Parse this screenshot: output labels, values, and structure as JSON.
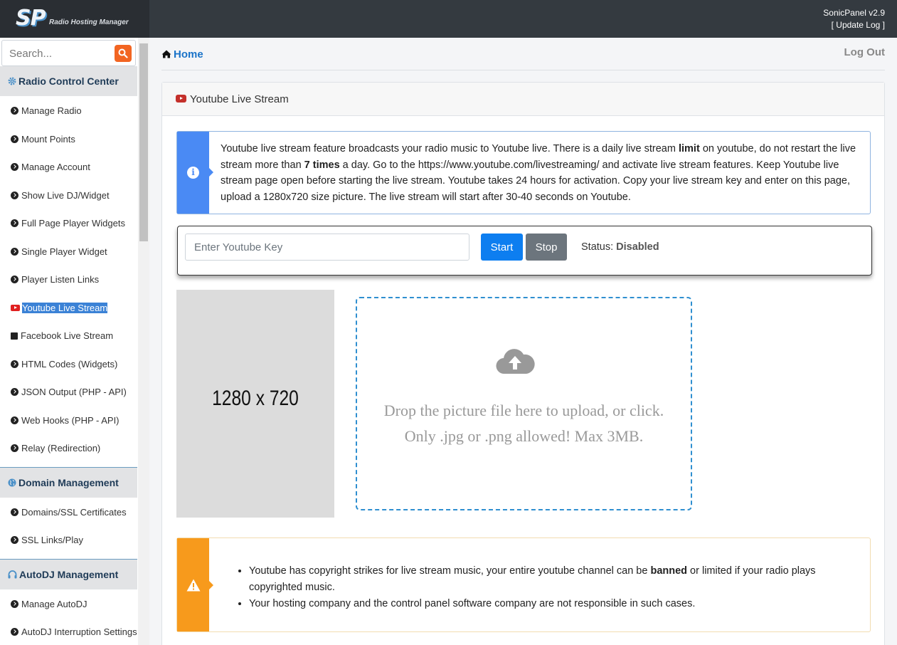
{
  "header": {
    "logo": "SP",
    "logo_subtitle": "Radio Hosting Manager",
    "version": "SonicPanel v2.9",
    "update_log": "[ Update Log ]"
  },
  "sidebar": {
    "search_placeholder": "Search...",
    "sections": [
      {
        "title": "Radio Control Center",
        "items": [
          "Manage Radio",
          "Mount Points",
          "Manage Account",
          "Show Live DJ/Widget",
          "Full Page Player Widgets",
          "Single Player Widget",
          "Player Listen Links",
          "Youtube Live Stream",
          "Facebook Live Stream",
          "HTML Codes (Widgets)",
          "JSON Output (PHP - API)",
          "Web Hooks (PHP - API)",
          "Relay (Redirection)"
        ]
      },
      {
        "title": "Domain Management",
        "items": [
          "Domains/SSL Certificates",
          "SSL Links/Play"
        ]
      },
      {
        "title": "AutoDJ Management",
        "items": [
          "Manage AutoDJ",
          "AutoDJ Interruption Settings"
        ]
      }
    ]
  },
  "main": {
    "breadcrumb_home": "Home",
    "logout": "Log Out",
    "card_title": "Youtube Live Stream",
    "info": {
      "t1": "Youtube live stream feature broadcasts your radio music to Youtube live. There is a daily live stream ",
      "b1": "limit",
      "t2": " on youtube, do not restart the live stream more than ",
      "b2": "7 times",
      "t3": " a day. Go to the https://www.youtube.com/livestreaming/ and activate live stream features. Keep Youtube live stream page open before starting the live stream. Youtube takes 24 hours for activation. Copy your live stream key and enter on this page, upload a 1280x720 size picture. The live stream will start after 30-40 seconds on Youtube."
    },
    "key_placeholder": "Enter Youtube Key",
    "start_label": "Start",
    "stop_label": "Stop",
    "status_label": "Status:",
    "status_value": "Disabled",
    "preview_text": "1280 x 720",
    "drop_line1": "Drop the picture file here to upload, or click.",
    "drop_line2": "Only .jpg or .png allowed! Max 3MB.",
    "warnings": {
      "w1a": "Youtube has copyright strikes for live stream music, your entire youtube channel can be ",
      "w1b": "banned",
      "w1c": " or limited if your radio plays copyrighted music.",
      "w2": "Your hosting company and the control panel software company are not responsible in such cases."
    }
  },
  "colors": {
    "topbar": "#343a40",
    "accent": "#0d7ef0",
    "search_button": "#f26522",
    "info": "#4a8af4",
    "warning": "#f79a1c"
  }
}
